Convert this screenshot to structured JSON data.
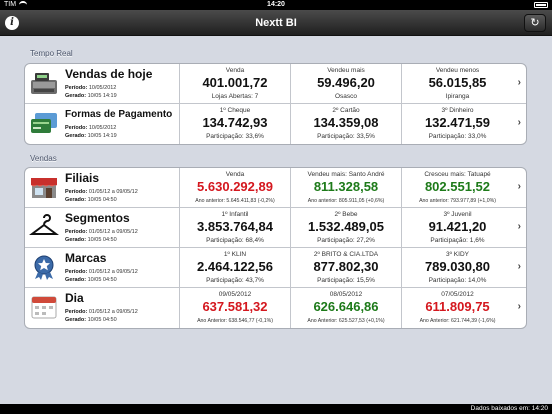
{
  "status": {
    "carrier": "TIM",
    "time": "14:20"
  },
  "nav": {
    "title": "Nextt BI"
  },
  "sections": {
    "tempo_real": "Tempo Real",
    "vendas": "Vendas"
  },
  "tempo_real": [
    {
      "name": "Vendas de hoje",
      "periodo_label": "Período:",
      "periodo": "10/05/2012",
      "gerado_label": "Gerado:",
      "gerado": "10/05 14:19",
      "icon": "cash-register-icon",
      "cells": [
        {
          "label": "Venda",
          "value": "401.001,72",
          "sub": "Lojas Abertas: 7"
        },
        {
          "label": "Vendeu mais",
          "value": "59.496,20",
          "sub": "Osasco"
        },
        {
          "label": "Vendeu menos",
          "value": "56.015,85",
          "sub": "Ipiranga"
        }
      ]
    },
    {
      "name": "Formas de Pagamento",
      "periodo_label": "Período:",
      "periodo": "10/05/2012",
      "gerado_label": "Gerado:",
      "gerado": "10/05 14:19",
      "icon": "payment-cards-icon",
      "cells": [
        {
          "label": "1º Cheque",
          "value": "134.742,93",
          "sub": "Participação: 33,6%"
        },
        {
          "label": "2º Cartão",
          "value": "134.359,08",
          "sub": "Participação: 33,5%"
        },
        {
          "label": "3º Dinheiro",
          "value": "132.471,59",
          "sub": "Participação: 33,0%"
        }
      ]
    }
  ],
  "vendas": [
    {
      "name": "Filiais",
      "periodo_label": "Período:",
      "periodo": "01/05/12 a 09/05/12",
      "gerado_label": "Gerado:",
      "gerado": "10/05 04:50",
      "icon": "store-icon",
      "cells": [
        {
          "label": "Venda",
          "value": "5.630.292,89",
          "sub": "Ano anterior: 5.645.411,83 (-0,2%)",
          "color": "red"
        },
        {
          "label": "Vendeu mais: Santo André",
          "value": "811.328,58",
          "sub": "Ano anterior: 805.911,05 (+0,6%)",
          "color": "green"
        },
        {
          "label": "Cresceu mais: Tatuapé",
          "value": "802.551,52",
          "sub": "Ano anterior: 793.977,89 (+1,0%)",
          "color": "green"
        }
      ]
    },
    {
      "name": "Segmentos",
      "periodo_label": "Período:",
      "periodo": "01/05/12 a 09/05/12",
      "gerado_label": "Gerado:",
      "gerado": "10/05 04:50",
      "icon": "hanger-icon",
      "cells": [
        {
          "label": "1º Infantil",
          "value": "3.853.764,84",
          "sub": "Participação: 68,4%"
        },
        {
          "label": "2º Bebe",
          "value": "1.532.489,05",
          "sub": "Participação: 27,2%"
        },
        {
          "label": "3º Juvenil",
          "value": "91.421,20",
          "sub": "Participação: 1,6%"
        }
      ]
    },
    {
      "name": "Marcas",
      "periodo_label": "Período:",
      "periodo": "01/05/12 a 09/05/12",
      "gerado_label": "Gerado:",
      "gerado": "10/05 04:50",
      "icon": "brand-badge-icon",
      "cells": [
        {
          "label": "1º KLIN",
          "value": "2.464.122,56",
          "sub": "Participação: 43,7%"
        },
        {
          "label": "2º BRITO & CIA.LTDA",
          "value": "877.802,30",
          "sub": "Participação: 15,5%"
        },
        {
          "label": "3º KIDY",
          "value": "789.030,80",
          "sub": "Participação: 14,0%"
        }
      ]
    },
    {
      "name": "Dia",
      "periodo_label": "Período:",
      "periodo": "01/05/12 a 09/05/12",
      "gerado_label": "Gerado:",
      "gerado": "10/05 04:50",
      "icon": "calendar-icon",
      "cells": [
        {
          "label": "09/05/2012",
          "value": "637.581,32",
          "sub": "Ano Anterior: 638.546,77 (-0,1%)",
          "color": "red"
        },
        {
          "label": "08/05/2012",
          "value": "626.646,86",
          "sub": "Ano Anterior: 625.527,53 (+0,1%)",
          "color": "green"
        },
        {
          "label": "07/05/2012",
          "value": "611.809,75",
          "sub": "Ano Anterior: 621.744,39 (-1,6%)",
          "color": "red"
        }
      ]
    }
  ],
  "footer": {
    "text": "Dados baixados em: 14:20"
  }
}
